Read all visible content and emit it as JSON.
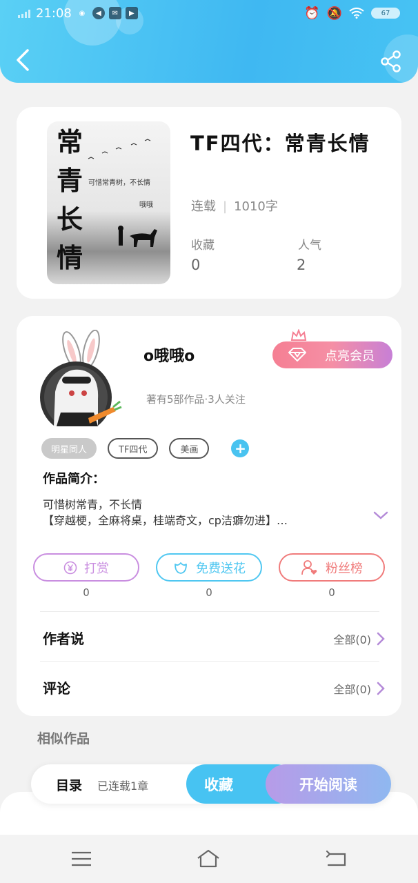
{
  "status_bar": {
    "time": "21:08",
    "battery": "67"
  },
  "book": {
    "cover_title": "常青长情",
    "cover_subtitle": "可惜常青树，不长情",
    "cover_author": "哦哦",
    "title": "TF四代：常青长情",
    "status": "连载",
    "word_count": "1010字",
    "favorites_label": "收藏",
    "favorites_value": "0",
    "popularity_label": "人气",
    "popularity_value": "2"
  },
  "author": {
    "name": "o哦哦o",
    "stats": "著有5部作品·3人关注",
    "vip_button": "点亮会员",
    "tags": [
      "明星同人",
      "TF四代",
      "美画"
    ],
    "intro_label": "作品简介：",
    "intro_line1": "可惜树常青，不长情",
    "intro_line2": "【穿越梗，全麻将桌，桂端奇文，cp洁癖勿进】…"
  },
  "actions": [
    {
      "label": "打赏",
      "count": "0"
    },
    {
      "label": "免费送花",
      "count": "0"
    },
    {
      "label": "粉丝榜",
      "count": "0"
    }
  ],
  "sections": {
    "author_says": {
      "label": "作者说",
      "right": "全部(0)"
    },
    "comments": {
      "label": "评论",
      "right": "全部(0)"
    }
  },
  "similar_label": "相似作品",
  "read_bar": {
    "toc_label": "目录",
    "toc_info": "已连载1章",
    "collect_button": "收藏",
    "read_button": "开始阅读"
  },
  "colors": {
    "header_blue": "#47c3f2",
    "reward_purple": "#c98ee0",
    "flower_blue": "#4fc7f1",
    "fans_red": "#f07b7b"
  }
}
